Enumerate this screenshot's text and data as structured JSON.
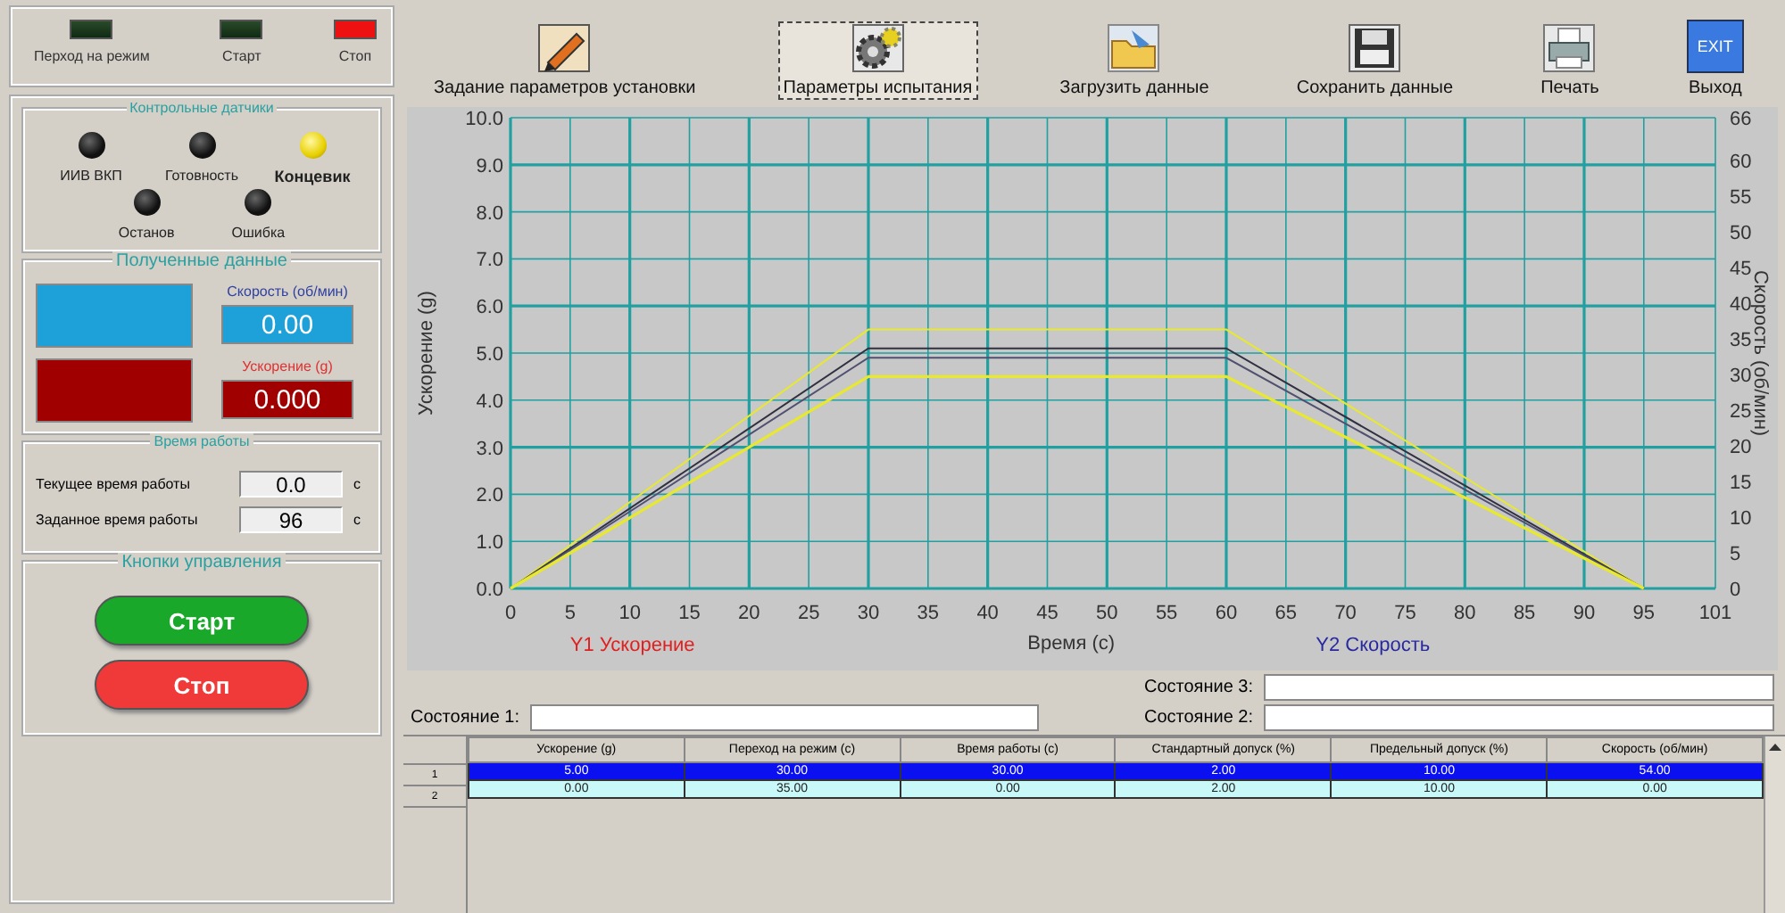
{
  "indicators": [
    {
      "label": "Перход на режим",
      "on": false
    },
    {
      "label": "Старт",
      "on": false
    },
    {
      "label": "Стоп",
      "on": true
    }
  ],
  "sensors": {
    "title": "Контрольные датчики",
    "items": [
      {
        "label": "ИИВ ВКП",
        "on": false
      },
      {
        "label": "Готовность",
        "on": false
      },
      {
        "label": "Концевик",
        "on": true
      },
      {
        "label": "Останов",
        "on": false
      },
      {
        "label": "Ошибка",
        "on": false
      }
    ]
  },
  "received": {
    "title": "Полученные данные",
    "speed": {
      "label": "Скорость (об/мин)",
      "value": "0.00"
    },
    "accel": {
      "label": "Ускорение (g)",
      "value": "0.000"
    }
  },
  "work_time": {
    "title": "Время работы",
    "rows": [
      {
        "label": "Текущее время работы",
        "value": "0.0",
        "unit": "с"
      },
      {
        "label": "Заданное время работы",
        "value": "96",
        "unit": "с"
      }
    ]
  },
  "controls": {
    "title": "Кнопки управления",
    "buttons": [
      {
        "label": "Старт",
        "kind": "start"
      },
      {
        "label": "Стоп",
        "kind": "stop"
      }
    ]
  },
  "toolbar": [
    {
      "label": "Задание параметров установки",
      "kind": "pencil",
      "selected": false
    },
    {
      "label": "Параметры испытания",
      "kind": "gear",
      "selected": true
    },
    {
      "label": "Загрузить данные",
      "kind": "folder",
      "selected": false
    },
    {
      "label": "Сохранить данные",
      "kind": "floppy",
      "selected": false
    },
    {
      "label": "Печать",
      "kind": "printer",
      "selected": false
    },
    {
      "label": "Выход",
      "kind": "exit",
      "selected": false,
      "icon_text": "EXIT"
    }
  ],
  "chart": {
    "legend_y1": "Y1 Ускорение",
    "legend_y2": "Y2 Скорость",
    "chart_data": {
      "type": "line",
      "xlabel": "Время (с)",
      "ylabel": "Ускорение (g)",
      "y2label": "Скорость (об/мин)",
      "xlim": [
        0,
        101
      ],
      "ylim": [
        0,
        10
      ],
      "y2lim": [
        0,
        66
      ],
      "xticks": [
        0,
        5,
        10,
        15,
        20,
        25,
        30,
        35,
        40,
        45,
        50,
        55,
        60,
        65,
        70,
        75,
        80,
        85,
        90,
        95,
        101
      ],
      "yticks": [
        {
          "value": 0,
          "label": "0.0"
        },
        {
          "value": 1,
          "label": "1.0"
        },
        {
          "value": 2,
          "label": "2.0"
        },
        {
          "value": 3,
          "label": "3.0"
        },
        {
          "value": 4,
          "label": "4.0"
        },
        {
          "value": 5,
          "label": "5.0"
        },
        {
          "value": 6,
          "label": "6.0"
        },
        {
          "value": 7,
          "label": "7.0"
        },
        {
          "value": 8,
          "label": "8.0"
        },
        {
          "value": 9,
          "label": "9.0"
        },
        {
          "value": 10,
          "label": "10.0"
        }
      ],
      "y2ticks": [
        0,
        5,
        10,
        15,
        20,
        25,
        30,
        35,
        40,
        45,
        50,
        55,
        60,
        66
      ],
      "x": [
        0,
        30,
        60,
        95
      ],
      "grid": true,
      "series": [
        {
          "color": "#e8e830",
          "values": [
            0,
            5.5,
            5.5,
            0
          ]
        },
        {
          "color": "#303040",
          "values": [
            0,
            5.1,
            5.1,
            0
          ]
        },
        {
          "color": "#505070",
          "values": [
            0,
            4.9,
            4.9,
            0
          ]
        },
        {
          "color": "#e8e830",
          "values": [
            0,
            4.5,
            4.5,
            0
          ]
        }
      ]
    }
  },
  "status_fields": [
    {
      "label": "Состояние 3:"
    },
    {
      "label": "Состояние 1:"
    },
    {
      "label": "Состояние 2:"
    }
  ],
  "table": {
    "columns": [
      "Ускорение (g)",
      "Переход на режим (с)",
      "Время работы (с)",
      "Стандартный допуск (%)",
      "Предельный допуск (%)",
      "Скорость (об/мин)"
    ],
    "rows": [
      {
        "index": "1",
        "selected": true,
        "cells": [
          "5.00",
          "30.00",
          "30.00",
          "2.00",
          "10.00",
          "54.00"
        ]
      },
      {
        "index": "2",
        "selected": false,
        "cells": [
          "0.00",
          "35.00",
          "0.00",
          "2.00",
          "10.00",
          "0.00"
        ]
      }
    ]
  }
}
